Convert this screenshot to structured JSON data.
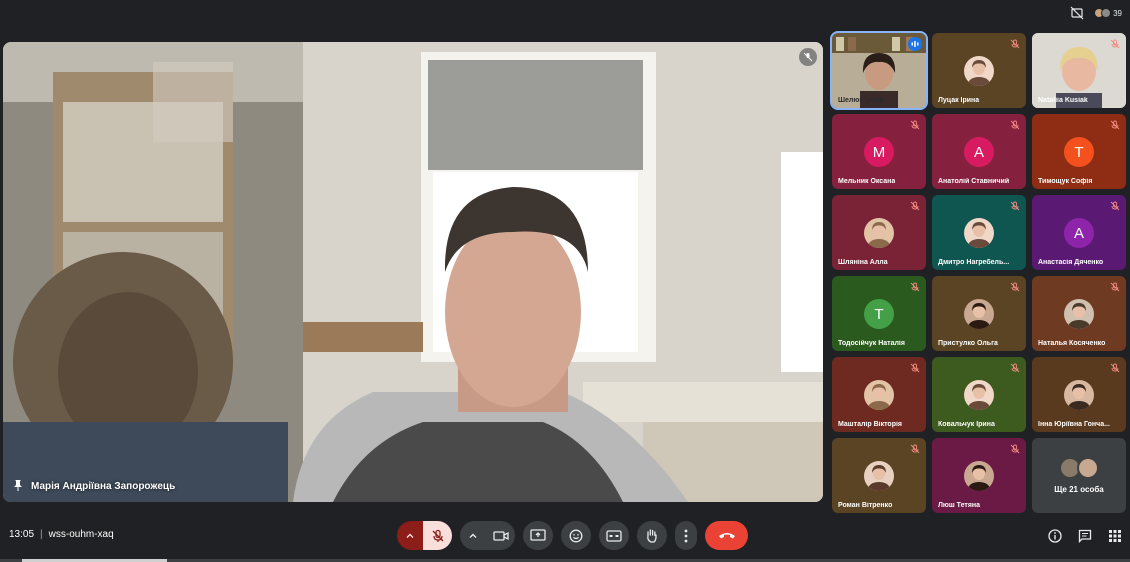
{
  "top": {
    "participant_count": "39",
    "icons": [
      "no-camera-icon",
      "people-icon"
    ]
  },
  "main": {
    "speaker_name": "Марія Андріївна Запорожець",
    "muted": true
  },
  "participants": [
    {
      "name": "Шелюк Ірина",
      "type": "video",
      "muted": false,
      "speaking": true,
      "bg": "#c9c2b2"
    },
    {
      "name": "Луцак Ірина",
      "type": "photo",
      "muted": true,
      "bg": "#5a4424"
    },
    {
      "name": "Nataliia Kusiak",
      "type": "video",
      "muted": true,
      "bg": "#d9d6d0"
    },
    {
      "name": "Мельник Оксана",
      "type": "letter",
      "letter": "M",
      "color": "#d81b60",
      "muted": true,
      "bg": "#86203f"
    },
    {
      "name": "Анатолій Ставничий",
      "type": "letter",
      "letter": "A",
      "color": "#d81b60",
      "muted": true,
      "bg": "#86203f"
    },
    {
      "name": "Тимощук Софія",
      "type": "letter",
      "letter": "T",
      "color": "#f4511e",
      "muted": true,
      "bg": "#8e2d14"
    },
    {
      "name": "Шляніна Алла",
      "type": "photo",
      "muted": true,
      "bg": "#7a2236"
    },
    {
      "name": "Дмитро Нагребель...",
      "type": "photo",
      "muted": true,
      "bg": "#0f5650"
    },
    {
      "name": "Анастасія Дяченко",
      "type": "letter",
      "letter": "A",
      "color": "#8e24aa",
      "muted": true,
      "bg": "#5a1a73"
    },
    {
      "name": "Тодосійчук Наталія",
      "type": "letter",
      "letter": "T",
      "color": "#43a047",
      "muted": true,
      "bg": "#2a5a1d"
    },
    {
      "name": "Пристулко Ольга",
      "type": "photo",
      "muted": true,
      "bg": "#5a4424"
    },
    {
      "name": "Наталья Косяченко",
      "type": "photo",
      "muted": true,
      "bg": "#6e3a22"
    },
    {
      "name": "Машталір Вікторія",
      "type": "photo",
      "muted": true,
      "bg": "#6e2a20"
    },
    {
      "name": "Ковальчук Ірина",
      "type": "photo",
      "muted": true,
      "bg": "#3d5a1f"
    },
    {
      "name": "Інна Юріївна Гонча...",
      "type": "photo",
      "muted": true,
      "bg": "#5a3a1e"
    },
    {
      "name": "Роман Вітренко",
      "type": "photo",
      "muted": true,
      "bg": "#5a4424"
    },
    {
      "name": "Люш Тетяна",
      "type": "photo",
      "muted": true,
      "bg": "#6a1a44"
    },
    {
      "name": "Ще 21 особа",
      "type": "more",
      "bg": "#3c4043"
    }
  ],
  "meeting": {
    "time": "13:05",
    "code": "wss-ouhm-xaq"
  },
  "colors": {
    "muted_accent": "#f28b82",
    "end_call": "#ea4335",
    "mic_off_bg": "#f9dedc",
    "mic_toggle_bg": "#8c1d18"
  }
}
